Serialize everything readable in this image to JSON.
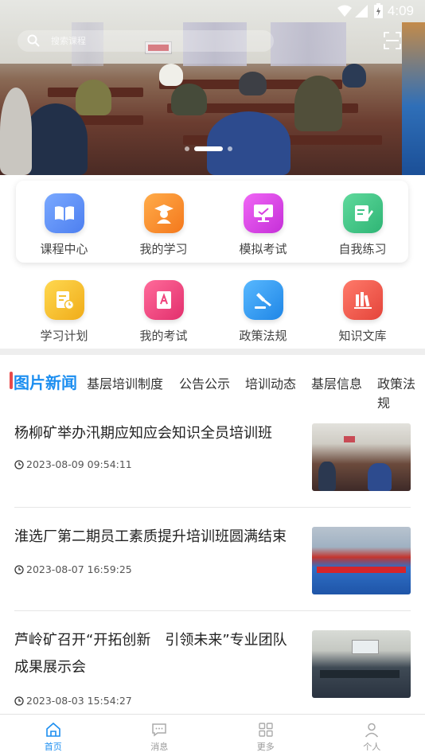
{
  "status_bar": {
    "time": "4:09"
  },
  "search": {
    "placeholder": "搜索课程"
  },
  "banner": {
    "slide_count": 3,
    "active_slide": 2
  },
  "menu": {
    "row1": [
      {
        "label": "课程中心",
        "icon": "book-icon",
        "color": "#5b8ef7"
      },
      {
        "label": "我的学习",
        "icon": "graduate-icon",
        "color": "#f98b2c"
      },
      {
        "label": "模拟考试",
        "icon": "monitor-icon",
        "color": "#d63fe0"
      },
      {
        "label": "自我练习",
        "icon": "edit-note-icon",
        "color": "#3fc486"
      }
    ],
    "row2": [
      {
        "label": "学习计划",
        "icon": "plan-icon",
        "color": "#f4c132"
      },
      {
        "label": "我的考试",
        "icon": "exam-doc-icon",
        "color": "#f0447c"
      },
      {
        "label": "政策法规",
        "icon": "gavel-icon",
        "color": "#2f9bf0"
      },
      {
        "label": "知识文库",
        "icon": "library-icon",
        "color": "#f05d4e"
      }
    ]
  },
  "tabs": {
    "active": "图片新闻",
    "items": [
      "基层培训制度",
      "公告公示",
      "培训动态",
      "基层信息",
      "政策法规"
    ]
  },
  "news": [
    {
      "title": "杨柳矿举办汛期应知应会知识全员培训班",
      "time": "2023-08-09 09:54:11"
    },
    {
      "title": "淮选厂第二期员工素质提升培训班圆满结束",
      "time": "2023-08-07 16:59:25"
    },
    {
      "title": "芦岭矿召开“开拓创新　引领未来”专业团队成果展示会",
      "time": "2023-08-03 15:54:27"
    }
  ],
  "bottom_nav": [
    {
      "label": "首页",
      "icon": "home-icon",
      "active": true
    },
    {
      "label": "消息",
      "icon": "message-icon",
      "active": false
    },
    {
      "label": "更多",
      "icon": "grid-icon",
      "active": false
    },
    {
      "label": "个人",
      "icon": "user-icon",
      "active": false
    }
  ],
  "colors": {
    "accent": "#1c8ef0",
    "tab_marker": "#e84a4a"
  }
}
